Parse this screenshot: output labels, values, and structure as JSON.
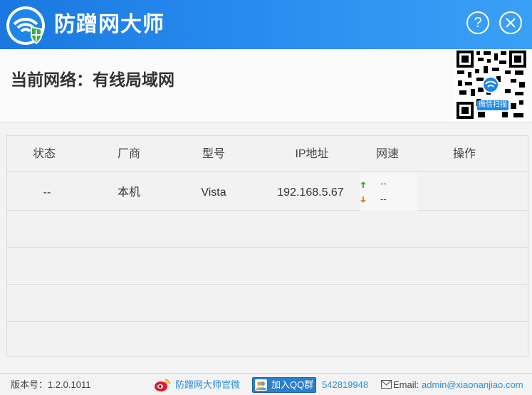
{
  "app": {
    "title": "防蹭网大师"
  },
  "titlebar": {
    "help_label": "?"
  },
  "network": {
    "label": "当前网络：有线局域网"
  },
  "qr": {
    "caption": "微信扫描"
  },
  "table": {
    "headers": [
      "状态",
      "厂商",
      "型号",
      "IP地址",
      "网速",
      "操作"
    ],
    "rows": [
      {
        "status": "--",
        "vendor": "本机",
        "model": "Vista",
        "ip": "192.168.5.67",
        "up": "--",
        "down": "--",
        "action": ""
      }
    ]
  },
  "statusbar": {
    "version": "版本号：1.2.0.1011",
    "weibo_label": "防蹭网大师官微",
    "qq_label": "加入QQ群",
    "qq_number": "542819948",
    "email_label": "Email:",
    "email_value": "admin@xiaonanjiao.com"
  },
  "colors": {
    "titlebar": "#2a8ff0",
    "link": "#2a8fd8",
    "up_arrow": "#3cb043",
    "down_arrow": "#e8812a"
  }
}
